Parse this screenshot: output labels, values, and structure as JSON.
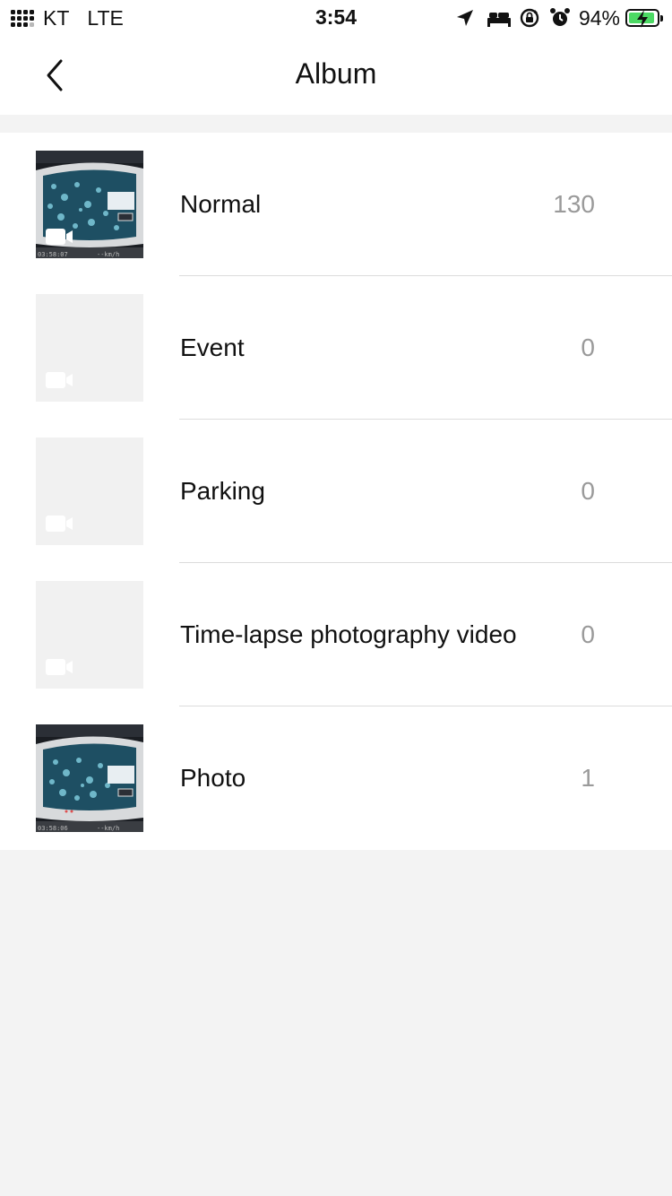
{
  "status_bar": {
    "carrier": "KT",
    "network": "LTE",
    "time": "3:54",
    "battery": "94%",
    "battery_level": 0.94,
    "battery_color": "#4cd964",
    "icons": [
      "location-arrow-icon",
      "bed-icon",
      "orientation-lock-icon",
      "alarm-icon",
      "battery-charging-icon"
    ]
  },
  "header": {
    "title": "Album",
    "back_icon": "chevron-left-icon"
  },
  "albums": [
    {
      "name": "Normal",
      "count": "130",
      "thumbnail": "video-preview",
      "icon": "video-camera-icon"
    },
    {
      "name": "Event",
      "count": "0",
      "thumbnail": "empty",
      "icon": "video-camera-icon"
    },
    {
      "name": "Parking",
      "count": "0",
      "thumbnail": "empty",
      "icon": "video-camera-icon"
    },
    {
      "name": "Time-lapse photography video",
      "count": "0",
      "thumbnail": "empty",
      "icon": "video-camera-icon"
    },
    {
      "name": "Photo",
      "count": "1",
      "thumbnail": "photo-preview",
      "icon": ""
    }
  ],
  "colors": {
    "background": "#f3f3f3",
    "count_text": "#9a9a9a",
    "divider": "#dcdcdc"
  }
}
